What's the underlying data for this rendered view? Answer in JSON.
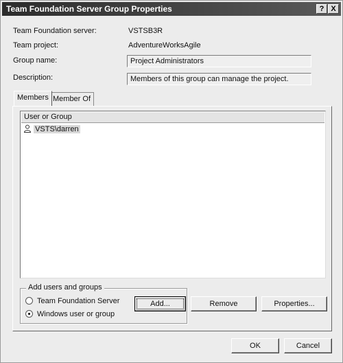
{
  "window": {
    "title": "Team Foundation Server Group Properties",
    "help_button": "?",
    "close_button": "X"
  },
  "properties": {
    "tfs_server_label": "Team Foundation server:",
    "tfs_server_value": "VSTSB3R",
    "team_project_label": "Team project:",
    "team_project_value": "AdventureWorksAgile",
    "group_name_label": "Group name:",
    "group_name_value": "Project Administrators",
    "description_label": "Description:",
    "description_value": "Members of this group can manage the project."
  },
  "tabs": [
    {
      "label": "Members",
      "active": true
    },
    {
      "label": "Member Of",
      "active": false
    }
  ],
  "members_list": {
    "column_header": "User or Group",
    "rows": [
      {
        "label": "VSTS\\darren",
        "icon": "user-icon"
      }
    ]
  },
  "add_group": {
    "title": "Add users and groups",
    "options": [
      {
        "label": "Team Foundation Server",
        "checked": false
      },
      {
        "label": "Windows user or group",
        "checked": true
      }
    ]
  },
  "buttons": {
    "add": "Add...",
    "remove": "Remove",
    "properties": "Properties...",
    "ok": "OK",
    "cancel": "Cancel"
  }
}
